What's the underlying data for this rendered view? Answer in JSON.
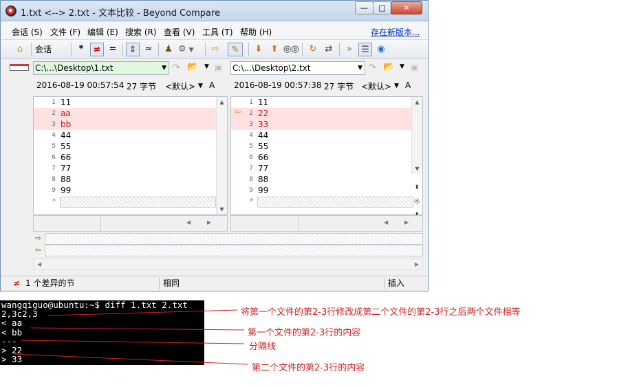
{
  "window": {
    "title": "1.txt <--> 2.txt - 文本比较 - Beyond Compare",
    "min_glyph": "—",
    "max_glyph": "□",
    "close_glyph": "✕"
  },
  "menu": {
    "items": [
      "会话 (S)",
      "文件 (F)",
      "编辑 (E)",
      "搜索 (R)",
      "查看 (V)",
      "工具 (T)",
      "帮助 (H)"
    ],
    "link": "存在新版本..."
  },
  "toolbar": {
    "session_label": "会话",
    "icons": [
      "home-icon",
      "asterisk-icon",
      "not-equal-icon",
      "equal-icon",
      "align-icon",
      "approx-icon",
      "user-icon",
      "gear-icon",
      "next-icon",
      "edit-icon",
      "down-arrow-icon",
      "up-arrow-icon",
      "binoculars-icon",
      "refresh-icon",
      "swap-icon",
      "format-icon",
      "rules-icon",
      "web-icon"
    ]
  },
  "left": {
    "path": "C:\\...\\Desktop\\1.txt",
    "date": "2016-08-19 00:57:54",
    "size": "27 字节",
    "encoding": "<默认>",
    "font_glyph": "A",
    "lines": [
      {
        "n": "1",
        "t": "11",
        "diff": false
      },
      {
        "n": "2",
        "t": "aa",
        "diff": true
      },
      {
        "n": "3",
        "t": "bb",
        "diff": true
      },
      {
        "n": "4",
        "t": "44",
        "diff": false
      },
      {
        "n": "5",
        "t": "55",
        "diff": false
      },
      {
        "n": "6",
        "t": "66",
        "diff": false
      },
      {
        "n": "7",
        "t": "77",
        "diff": false
      },
      {
        "n": "8",
        "t": "88",
        "diff": false
      },
      {
        "n": "9",
        "t": "99",
        "diff": false
      }
    ],
    "end_marker": "*"
  },
  "right": {
    "path": "C:\\...\\Desktop\\2.txt",
    "date": "2016-08-19 00:57:38",
    "size": "27 字节",
    "encoding": "<默认>",
    "font_glyph": "A",
    "lines": [
      {
        "n": "1",
        "t": "11",
        "diff": false
      },
      {
        "n": "2",
        "t": "22",
        "diff": true
      },
      {
        "n": "3",
        "t": "33",
        "diff": true
      },
      {
        "n": "4",
        "t": "44",
        "diff": false
      },
      {
        "n": "5",
        "t": "55",
        "diff": false
      },
      {
        "n": "6",
        "t": "66",
        "diff": false
      },
      {
        "n": "7",
        "t": "77",
        "diff": false
      },
      {
        "n": "8",
        "t": "88",
        "diff": false
      },
      {
        "n": "9",
        "t": "99",
        "diff": false
      }
    ],
    "end_marker": "*"
  },
  "status": {
    "diff_count": "1 个差异的节",
    "same": "相同",
    "mode": "插入"
  },
  "terminal": {
    "lines": [
      "wangqiguo@ubuntu:~$ diff 1.txt 2.txt",
      "2,3c2,3",
      "< aa",
      "< bb",
      "---",
      "> 22",
      "> 33"
    ]
  },
  "annotations": [
    "将第一个文件的第2-3行修改成第二个文件的第2-3行之后两个文件相等",
    "第一个文件的第2-3行的内容",
    "分隔线",
    "第二个文件的第2-3行的内容"
  ],
  "colors": {
    "diff_bg": "#ffe1e1",
    "diff_text": "#c01010",
    "annotation": "#d42020",
    "path_left_bg": "#e2f7e0"
  }
}
